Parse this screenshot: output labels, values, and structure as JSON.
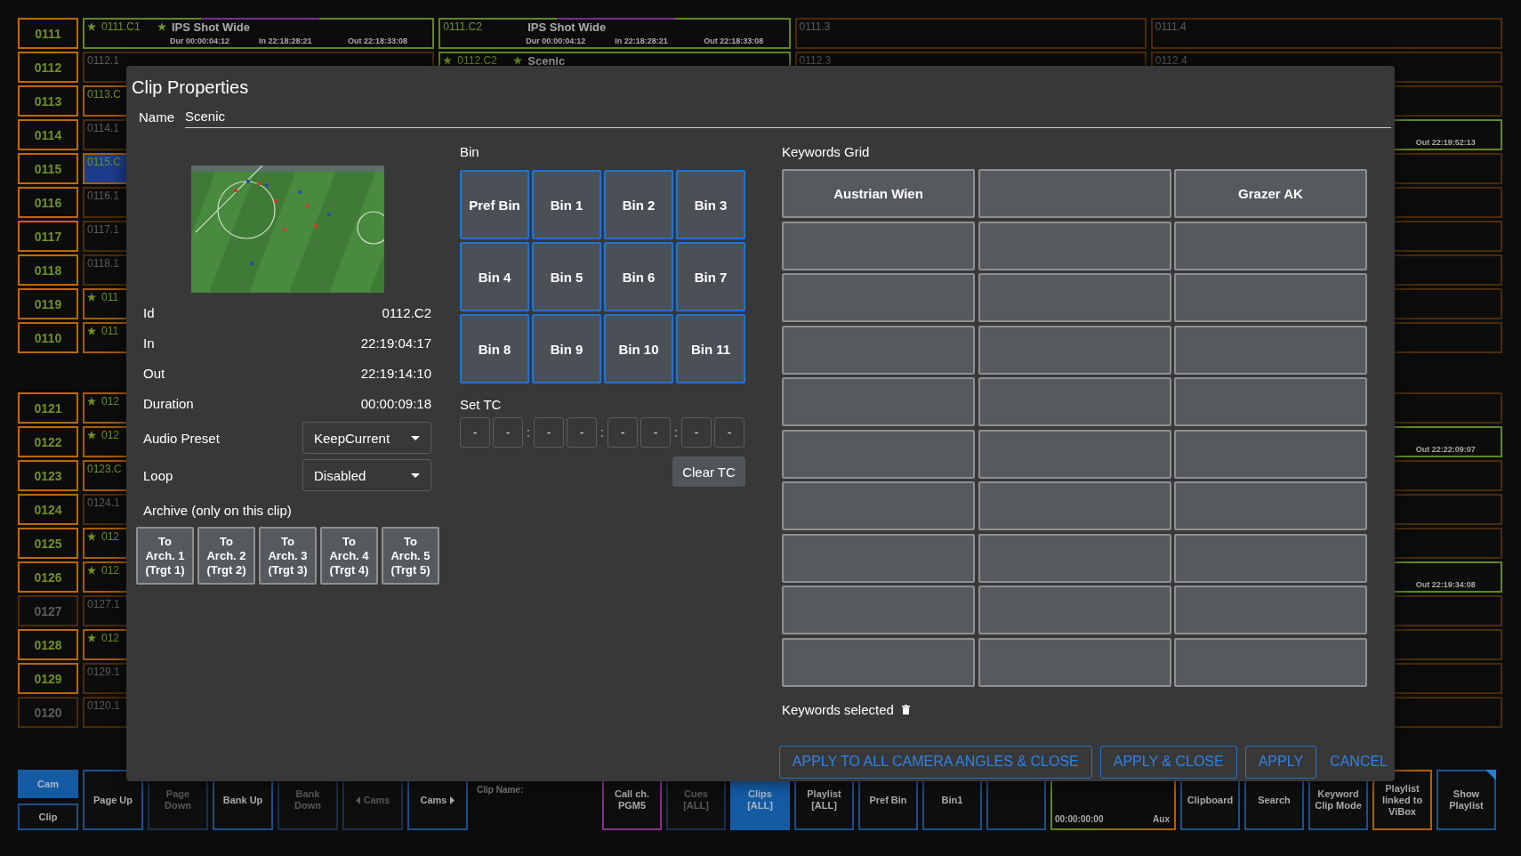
{
  "board": {
    "groups": [
      {
        "rows": [
          {
            "label": "0111",
            "active": true,
            "cells": [
              {
                "kind": "active",
                "starred": true,
                "id": "0111.C1",
                "title": "IPS Shot Wide",
                "dur": "Dur 00:00:04:12",
                "in": "In 22:18:28:21",
                "out": "Out 22:18:33:08"
              },
              {
                "kind": "active",
                "starred": false,
                "id": "0111.C2",
                "title": "IPS Shot Wide",
                "dur": "Dur 00:00:04:12",
                "in": "In 22:18:28:21",
                "out": "Out 22:18:33:08"
              },
              {
                "kind": "empty",
                "starred": false,
                "id": "0111.3"
              },
              {
                "kind": "empty",
                "starred": false,
                "id": "0111.4"
              }
            ]
          },
          {
            "label": "0112",
            "active": true,
            "cells": [
              {
                "kind": "empty",
                "starred": false,
                "id": "0112.1"
              },
              {
                "kind": "active",
                "starred": true,
                "id": "0112.C2",
                "title": "Scenic"
              },
              {
                "kind": "empty",
                "starred": false,
                "id": "0112.3"
              },
              {
                "kind": "empty",
                "starred": false,
                "id": "0112.4"
              }
            ]
          },
          {
            "label": "0113",
            "active": true,
            "cells": [
              {
                "kind": "recorded",
                "starred": false,
                "id": "0113.C"
              },
              {
                "kind": "empty"
              }
            ]
          },
          {
            "label": "0114",
            "active": true,
            "cells": [
              {
                "kind": "empty",
                "starred": false,
                "id": "0114.1"
              },
              {
                "kind": "active",
                "out": "Out 22:19:52:13"
              }
            ]
          },
          {
            "label": "0115",
            "active": true,
            "cells": [
              {
                "kind": "selected",
                "starred": false,
                "id": "0115.C"
              },
              {
                "kind": "empty"
              }
            ]
          },
          {
            "label": "0116",
            "active": true,
            "cells": [
              {
                "kind": "empty",
                "starred": false,
                "id": "0116.1"
              },
              {
                "kind": "empty"
              }
            ]
          },
          {
            "label": "0117",
            "active": true,
            "cells": [
              {
                "kind": "empty",
                "starred": false,
                "id": "0117.1"
              },
              {
                "kind": "empty"
              }
            ]
          },
          {
            "label": "0118",
            "active": true,
            "cells": [
              {
                "kind": "empty",
                "starred": false,
                "id": "0118.1"
              },
              {
                "kind": "empty"
              }
            ]
          },
          {
            "label": "0119",
            "active": true,
            "cells": [
              {
                "kind": "recorded",
                "starred": true,
                "id": "011"
              },
              {
                "kind": "empty"
              }
            ]
          },
          {
            "label": "0110",
            "active": true,
            "cells": [
              {
                "kind": "recorded",
                "starred": true,
                "id": "011"
              },
              {
                "kind": "empty"
              }
            ]
          }
        ]
      },
      {
        "rows": [
          {
            "label": "0121",
            "active": true,
            "cells": [
              {
                "kind": "recorded",
                "starred": true,
                "id": "012"
              },
              {
                "kind": "empty"
              }
            ]
          },
          {
            "label": "0122",
            "active": true,
            "cells": [
              {
                "kind": "recorded",
                "starred": true,
                "id": "012"
              },
              {
                "kind": "active",
                "out": "Out 22:22:09:07"
              }
            ]
          },
          {
            "label": "0123",
            "active": true,
            "cells": [
              {
                "kind": "recorded",
                "starred": false,
                "id": "0123.C"
              },
              {
                "kind": "empty"
              }
            ]
          },
          {
            "label": "0124",
            "active": true,
            "cells": [
              {
                "kind": "empty",
                "starred": false,
                "id": "0124.1"
              },
              {
                "kind": "empty"
              }
            ]
          },
          {
            "label": "0125",
            "active": true,
            "cells": [
              {
                "kind": "recorded",
                "starred": true,
                "id": "012"
              },
              {
                "kind": "empty"
              }
            ]
          },
          {
            "label": "0126",
            "active": true,
            "cells": [
              {
                "kind": "recorded",
                "starred": true,
                "id": "012"
              },
              {
                "kind": "active",
                "out": "Out 22:19:34:08"
              }
            ]
          },
          {
            "label": "0127",
            "active": false,
            "cells": [
              {
                "kind": "empty",
                "starred": false,
                "id": "0127.1"
              },
              {
                "kind": "empty"
              }
            ]
          },
          {
            "label": "0128",
            "active": true,
            "cells": [
              {
                "kind": "recorded",
                "starred": true,
                "id": "012"
              },
              {
                "kind": "empty"
              }
            ]
          },
          {
            "label": "0129",
            "active": true,
            "cells": [
              {
                "kind": "empty",
                "starred": false,
                "id": "0129.1"
              },
              {
                "kind": "empty"
              }
            ]
          },
          {
            "label": "0120",
            "active": false,
            "cells": [
              {
                "kind": "empty",
                "starred": false,
                "id": "0120.1"
              },
              {
                "kind": "empty"
              }
            ]
          }
        ]
      }
    ]
  },
  "dialog": {
    "title": "Clip Properties",
    "name": {
      "label": "Name",
      "value": "Scenic"
    },
    "properties": [
      {
        "label": "Id",
        "value": "0112.C2"
      },
      {
        "label": "In",
        "value": "22:19:04:17"
      },
      {
        "label": "Out",
        "value": "22:19:14:10"
      },
      {
        "label": "Duration",
        "value": "00:00:09:18"
      }
    ],
    "dropdowns": [
      {
        "label": "Audio Preset",
        "value": "KeepCurrent"
      },
      {
        "label": "Loop",
        "value": "Disabled"
      }
    ],
    "archive": {
      "label": "Archive (only on this clip)",
      "buttons": [
        "To\nArch. 1\n(Trgt 1)",
        "To\nArch. 2\n(Trgt 2)",
        "To\nArch. 3\n(Trgt 3)",
        "To\nArch. 4\n(Trgt 4)",
        "To\nArch. 5\n(Trgt 5)"
      ]
    },
    "bins": {
      "label": "Bin",
      "buttons": [
        "Pref Bin",
        "Bin 1",
        "Bin 2",
        "Bin 3",
        "Bin 4",
        "Bin 5",
        "Bin 6",
        "Bin 7",
        "Bin 8",
        "Bin 9",
        "Bin 10",
        "Bin 11"
      ]
    },
    "set_tc": {
      "label": "Set TC",
      "fields": [
        "-",
        "-",
        "-",
        "-",
        "-",
        "-",
        "-",
        "-"
      ],
      "separators": [
        ":",
        ":",
        ":"
      ],
      "clear_button": "Clear TC"
    },
    "keywords": {
      "label": "Keywords Grid",
      "selected_label": "Keywords selected",
      "cells": [
        {
          "kind": "keyword",
          "label": "Austrian Wien"
        },
        {
          "kind": "empty"
        },
        {
          "kind": "keyword",
          "label": "Grazer AK"
        },
        {
          "kind": "empty"
        },
        {
          "kind": "empty"
        },
        {
          "kind": "empty"
        },
        {
          "kind": "empty"
        },
        {
          "kind": "empty"
        },
        {
          "kind": "empty"
        },
        {
          "kind": "empty"
        },
        {
          "kind": "empty"
        },
        {
          "kind": "empty"
        },
        {
          "kind": "empty"
        },
        {
          "kind": "empty"
        },
        {
          "kind": "empty"
        },
        {
          "kind": "empty"
        },
        {
          "kind": "empty"
        },
        {
          "kind": "empty"
        },
        {
          "kind": "empty"
        },
        {
          "kind": "empty"
        },
        {
          "kind": "empty"
        },
        {
          "kind": "empty"
        },
        {
          "kind": "empty"
        },
        {
          "kind": "empty"
        },
        {
          "kind": "empty"
        },
        {
          "kind": "empty"
        },
        {
          "kind": "empty"
        },
        {
          "kind": "empty"
        },
        {
          "kind": "empty"
        },
        {
          "kind": "empty"
        }
      ]
    },
    "actions": [
      {
        "kind": "outlined",
        "label": "APPLY TO ALL CAMERA ANGLES & CLOSE"
      },
      {
        "kind": "outlined",
        "label": "APPLY & CLOSE"
      },
      {
        "kind": "outlined",
        "label": "APPLY"
      },
      {
        "kind": "text",
        "label": "CANCEL"
      }
    ]
  },
  "bottom_bar": {
    "mode": [
      {
        "label": "Cam",
        "selected": true
      },
      {
        "label": "Clip",
        "selected": false
      }
    ],
    "nav": [
      {
        "label": "Page Up",
        "disabled": false
      },
      {
        "label": "Page Down",
        "disabled": true
      },
      {
        "label": "Bank Up",
        "disabled": false
      },
      {
        "label": "Bank Down",
        "disabled": true
      },
      {
        "kind": "arrow_left",
        "label": "Cams",
        "disabled": true
      },
      {
        "kind": "arrow_right",
        "label": "Cams",
        "disabled": false
      }
    ],
    "clip_name_label": "Clip Name:",
    "buttons": [
      {
        "kind": "button",
        "label": "Call ch. PGM5",
        "color": "#8a2d8a",
        "selected": false,
        "disabled": false
      },
      {
        "kind": "button",
        "label": "Cues [ALL]",
        "color": "#1b2f48",
        "selected": false,
        "disabled": true
      },
      {
        "kind": "button",
        "label": "Clips [ALL]",
        "color": "#155ba4",
        "selected": true,
        "disabled": false
      },
      {
        "kind": "button",
        "label": "Playlist [ALL]",
        "color": "#1c4f8c",
        "selected": false,
        "disabled": false
      },
      {
        "kind": "button",
        "label": "Pref Bin",
        "color": "#1c4f8c",
        "selected": false,
        "disabled": false
      },
      {
        "kind": "button",
        "label": "Bin1",
        "color": "#1c4f8c",
        "selected": false,
        "disabled": false
      },
      {
        "kind": "blank",
        "color": "#1c4f8c"
      },
      {
        "kind": "timecode",
        "value": "00:00:00:00",
        "channel": "Aux"
      },
      {
        "kind": "button",
        "label": "Clipboard",
        "color": "#1c4f8c",
        "selected": false,
        "disabled": false
      },
      {
        "kind": "button",
        "label": "Search",
        "color": "#1c4f8c",
        "selected": false,
        "disabled": false
      },
      {
        "kind": "button",
        "label": "Keyword Clip Mode",
        "color": "#1c4f8c",
        "selected": false,
        "disabled": false
      },
      {
        "kind": "button",
        "label": "Playlist linked to ViBox",
        "color": "#b06000",
        "selected": false,
        "disabled": false,
        "flagged": false
      },
      {
        "kind": "button",
        "label": "Show Playlist",
        "color": "#1c4f8c",
        "selected": false,
        "disabled": false,
        "flagged": true
      }
    ]
  }
}
